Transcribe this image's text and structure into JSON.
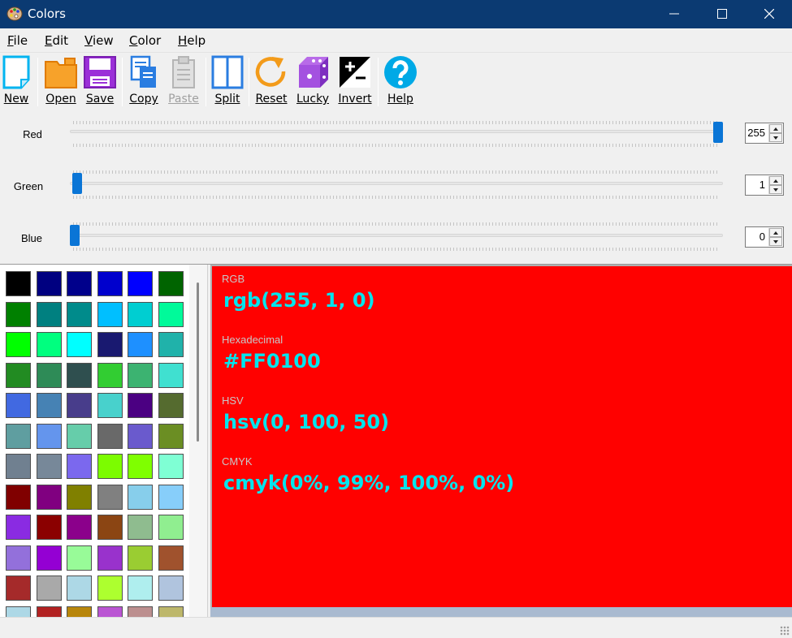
{
  "window": {
    "title": "Colors"
  },
  "menu": [
    {
      "label": "File",
      "key": "F",
      "rest": "ile"
    },
    {
      "label": "Edit",
      "key": "E",
      "rest": "dit"
    },
    {
      "label": "View",
      "key": "V",
      "rest": "iew"
    },
    {
      "label": "Color",
      "key": "C",
      "rest": "olor"
    },
    {
      "label": "Help",
      "key": "H",
      "rest": "elp"
    }
  ],
  "toolbar": {
    "new": "New",
    "open": "Open",
    "save": "Save",
    "copy": "Copy",
    "paste": "Paste",
    "split": "Split",
    "reset": "Reset",
    "lucky": "Lucky",
    "invert": "Invert",
    "help": "Help"
  },
  "sliders": [
    {
      "label": "Red",
      "value": "255",
      "max": 255
    },
    {
      "label": "Green",
      "value": "1",
      "max": 255
    },
    {
      "label": "Blue",
      "value": "0",
      "max": 255
    }
  ],
  "palette": [
    "#000000",
    "#000080",
    "#00008b",
    "#0000cd",
    "#0000ff",
    "#006400",
    "#008000",
    "#008080",
    "#008b8b",
    "#00bfff",
    "#00ced1",
    "#00fa9a",
    "#00ff00",
    "#00ff7f",
    "#00ffff",
    "#191970",
    "#1e90ff",
    "#20b2aa",
    "#228b22",
    "#2e8b57",
    "#2f4f4f",
    "#32cd32",
    "#3cb371",
    "#40e0d0",
    "#4169e1",
    "#4682b4",
    "#483d8b",
    "#48d1cc",
    "#4b0082",
    "#556b2f",
    "#5f9ea0",
    "#6495ed",
    "#66cdaa",
    "#696969",
    "#6a5acd",
    "#6b8e23",
    "#708090",
    "#778899",
    "#7b68ee",
    "#7cfc00",
    "#7fff00",
    "#7fffd4",
    "#800000",
    "#800080",
    "#808000",
    "#808080",
    "#87ceeb",
    "#87cefa",
    "#8a2be2",
    "#8b0000",
    "#8b008b",
    "#8b4513",
    "#8fbc8f",
    "#90ee90",
    "#9370db",
    "#9400d3",
    "#98fb98",
    "#9932cc",
    "#9acd32",
    "#a0522d",
    "#a52a2a",
    "#a9a9a9",
    "#add8e6",
    "#adff2f",
    "#afeeee",
    "#b0c4de",
    "#add8e6",
    "#b22222",
    "#b8860b",
    "#ba55d3",
    "#bc8f8f",
    "#bdb76b"
  ],
  "preview": {
    "background": "#FF0100",
    "text_color": "#00E5EE",
    "rgb_label": "RGB",
    "rgb_value": "rgb(255, 1, 0)",
    "hex_label": "Hexadecimal",
    "hex_value": "#FF0100",
    "hsv_label": "HSV",
    "hsv_value": "hsv(0, 100, 50)",
    "cmyk_label": "CMYK",
    "cmyk_value": "cmyk(0%, 99%, 100%, 0%)"
  }
}
